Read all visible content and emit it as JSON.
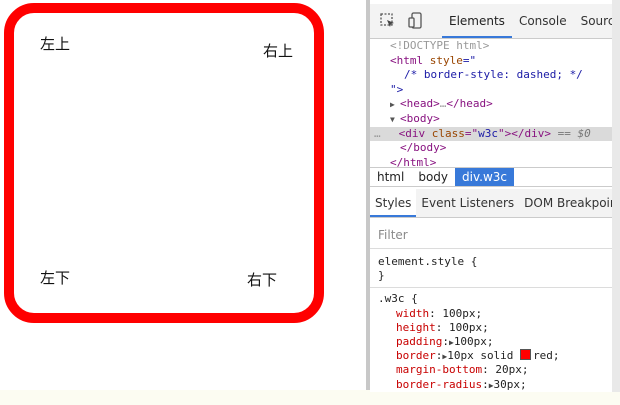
{
  "page": {
    "corners": {
      "top_left": "左上",
      "top_right": "右上",
      "bottom_left": "左下",
      "bottom_right": "右下"
    },
    "box_border_color": "#ff0000"
  },
  "devtools": {
    "toolbar_icons": [
      "inspect-element-icon",
      "device-mode-icon"
    ],
    "tabs": [
      {
        "label": "Elements",
        "active": true
      },
      {
        "label": "Console",
        "active": false
      },
      {
        "label": "Source",
        "active": false
      }
    ],
    "dom": {
      "doctype": "<!DOCTYPE html>",
      "html_open": "<html",
      "html_attr_name": "style",
      "html_attr_eq": "=\"",
      "style_comment": "/* border-style: dashed; */",
      "style_close": "\">",
      "head_open": "<head>",
      "head_ellipsis": "…",
      "head_close": "</head>",
      "body_open": "<body>",
      "div_open": "<div",
      "div_attr_name": "class",
      "div_attr_eq": "=\"",
      "div_attr_value": "w3c",
      "div_attr_end": "\">",
      "div_close": "</div>",
      "selected_marker": "== $0",
      "ellipsis_marker": "…",
      "body_close": "</body>",
      "html_close": "</html>"
    },
    "breadcrumbs": [
      {
        "label": "html",
        "active": false
      },
      {
        "label": "body",
        "active": false
      },
      {
        "label": "div.w3c",
        "active": true
      }
    ],
    "subtabs": [
      {
        "label": "Styles",
        "active": true
      },
      {
        "label": "Event Listeners",
        "active": false
      },
      {
        "label": "DOM Breakpoints",
        "active": false
      }
    ],
    "filter_placeholder": "Filter",
    "styles": {
      "element_style": "element.style {",
      "element_style_close": "}",
      "rule_selector": ".w3c {",
      "rule_close": "}",
      "declarations": [
        {
          "prop": "width",
          "value": "100px;"
        },
        {
          "prop": "height",
          "value": "100px;"
        },
        {
          "prop": "padding",
          "value": "100px;",
          "expandable": true
        },
        {
          "prop": "border",
          "value_pre": "10px solid ",
          "value_post": "red;",
          "expandable": true,
          "swatch": "#ff0000"
        },
        {
          "prop": "margin-bottom",
          "value": "20px;"
        },
        {
          "prop": "border-radius",
          "value": "30px;",
          "expandable": true
        }
      ]
    }
  }
}
